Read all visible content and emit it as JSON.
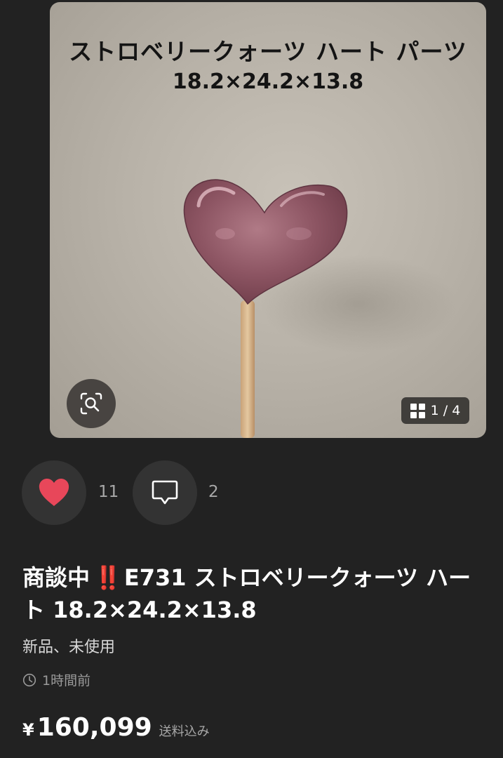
{
  "gallery": {
    "image_text": {
      "line1": "ストロベリークォーツ ハート パーツ",
      "line2": "18.2×24.2×13.8"
    },
    "counter": "1 / 4"
  },
  "actions": {
    "like_count": "11",
    "comment_count": "2"
  },
  "item": {
    "title_status": "商談中",
    "title_mark": "‼️",
    "title_text": "E731 ストロベリークォーツ ハート 18.2×24.2×13.8",
    "condition": "新品、未使用",
    "posted": "1時間前",
    "price_symbol": "¥",
    "price": "160,099",
    "shipping": "送料込み"
  },
  "icons": {
    "zoom": "zoom-scan-icon",
    "gallery": "grid-icon",
    "like": "heart-icon",
    "comment": "comment-icon",
    "time": "clock-icon"
  },
  "colors": {
    "background": "#222222",
    "button": "#333333",
    "heart": "#e8475a",
    "alert": "#e8373c"
  }
}
